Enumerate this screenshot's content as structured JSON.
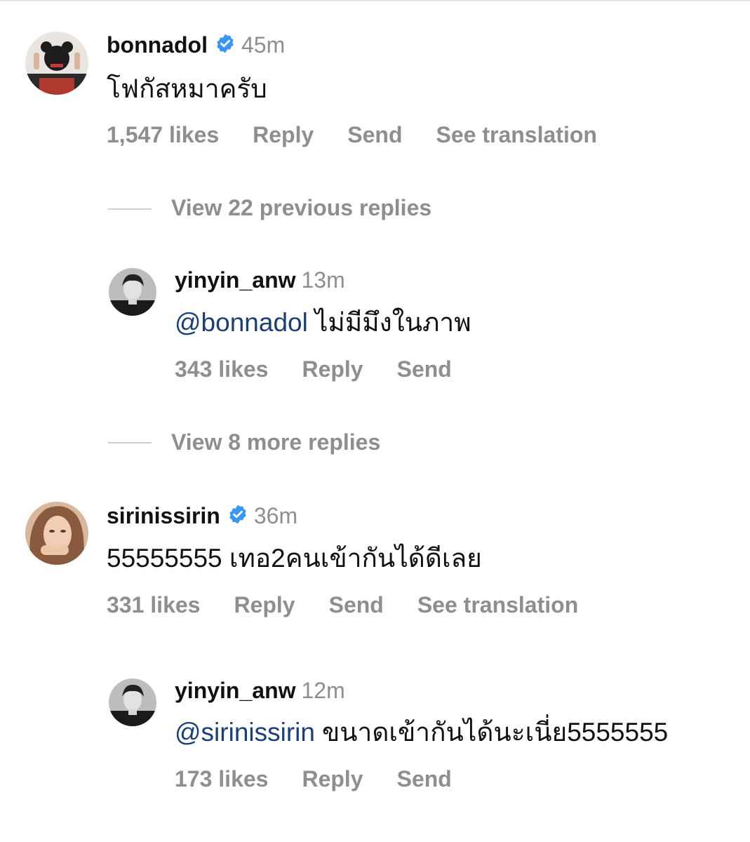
{
  "comments": [
    {
      "username": "bonnadol",
      "verified": true,
      "time": "45m",
      "text": "โฟกัสหมาครับ",
      "likes": "1,547 likes",
      "reply_label": "Reply",
      "send_label": "Send",
      "translate_label": "See translation"
    },
    {
      "username": "sirinissirin",
      "verified": true,
      "time": "36m",
      "text": "55555555 เทอ2คนเข้ากันได้ดีเลย",
      "likes": "331 likes",
      "reply_label": "Reply",
      "send_label": "Send",
      "translate_label": "See translation"
    }
  ],
  "replies": [
    {
      "username": "yinyin_anw",
      "time": "13m",
      "mention": "@bonnadol",
      "text": "ไม่มีมึงในภาพ",
      "likes": "343 likes",
      "reply_label": "Reply",
      "send_label": "Send"
    },
    {
      "username": "yinyin_anw",
      "time": "12m",
      "mention": "@sirinissirin",
      "text": "ขนาดเข้ากันได้นะเนี่ย5555555",
      "likes": "173 likes",
      "reply_label": "Reply",
      "send_label": "Send"
    }
  ],
  "view_previous_replies": "View 22 previous replies",
  "view_more_replies": "View 8 more replies",
  "colors": {
    "mention": "#1a3f78",
    "muted": "#8e8e8e",
    "verified": "#3897f0"
  },
  "icons": {
    "verified": "verified-badge-icon"
  }
}
